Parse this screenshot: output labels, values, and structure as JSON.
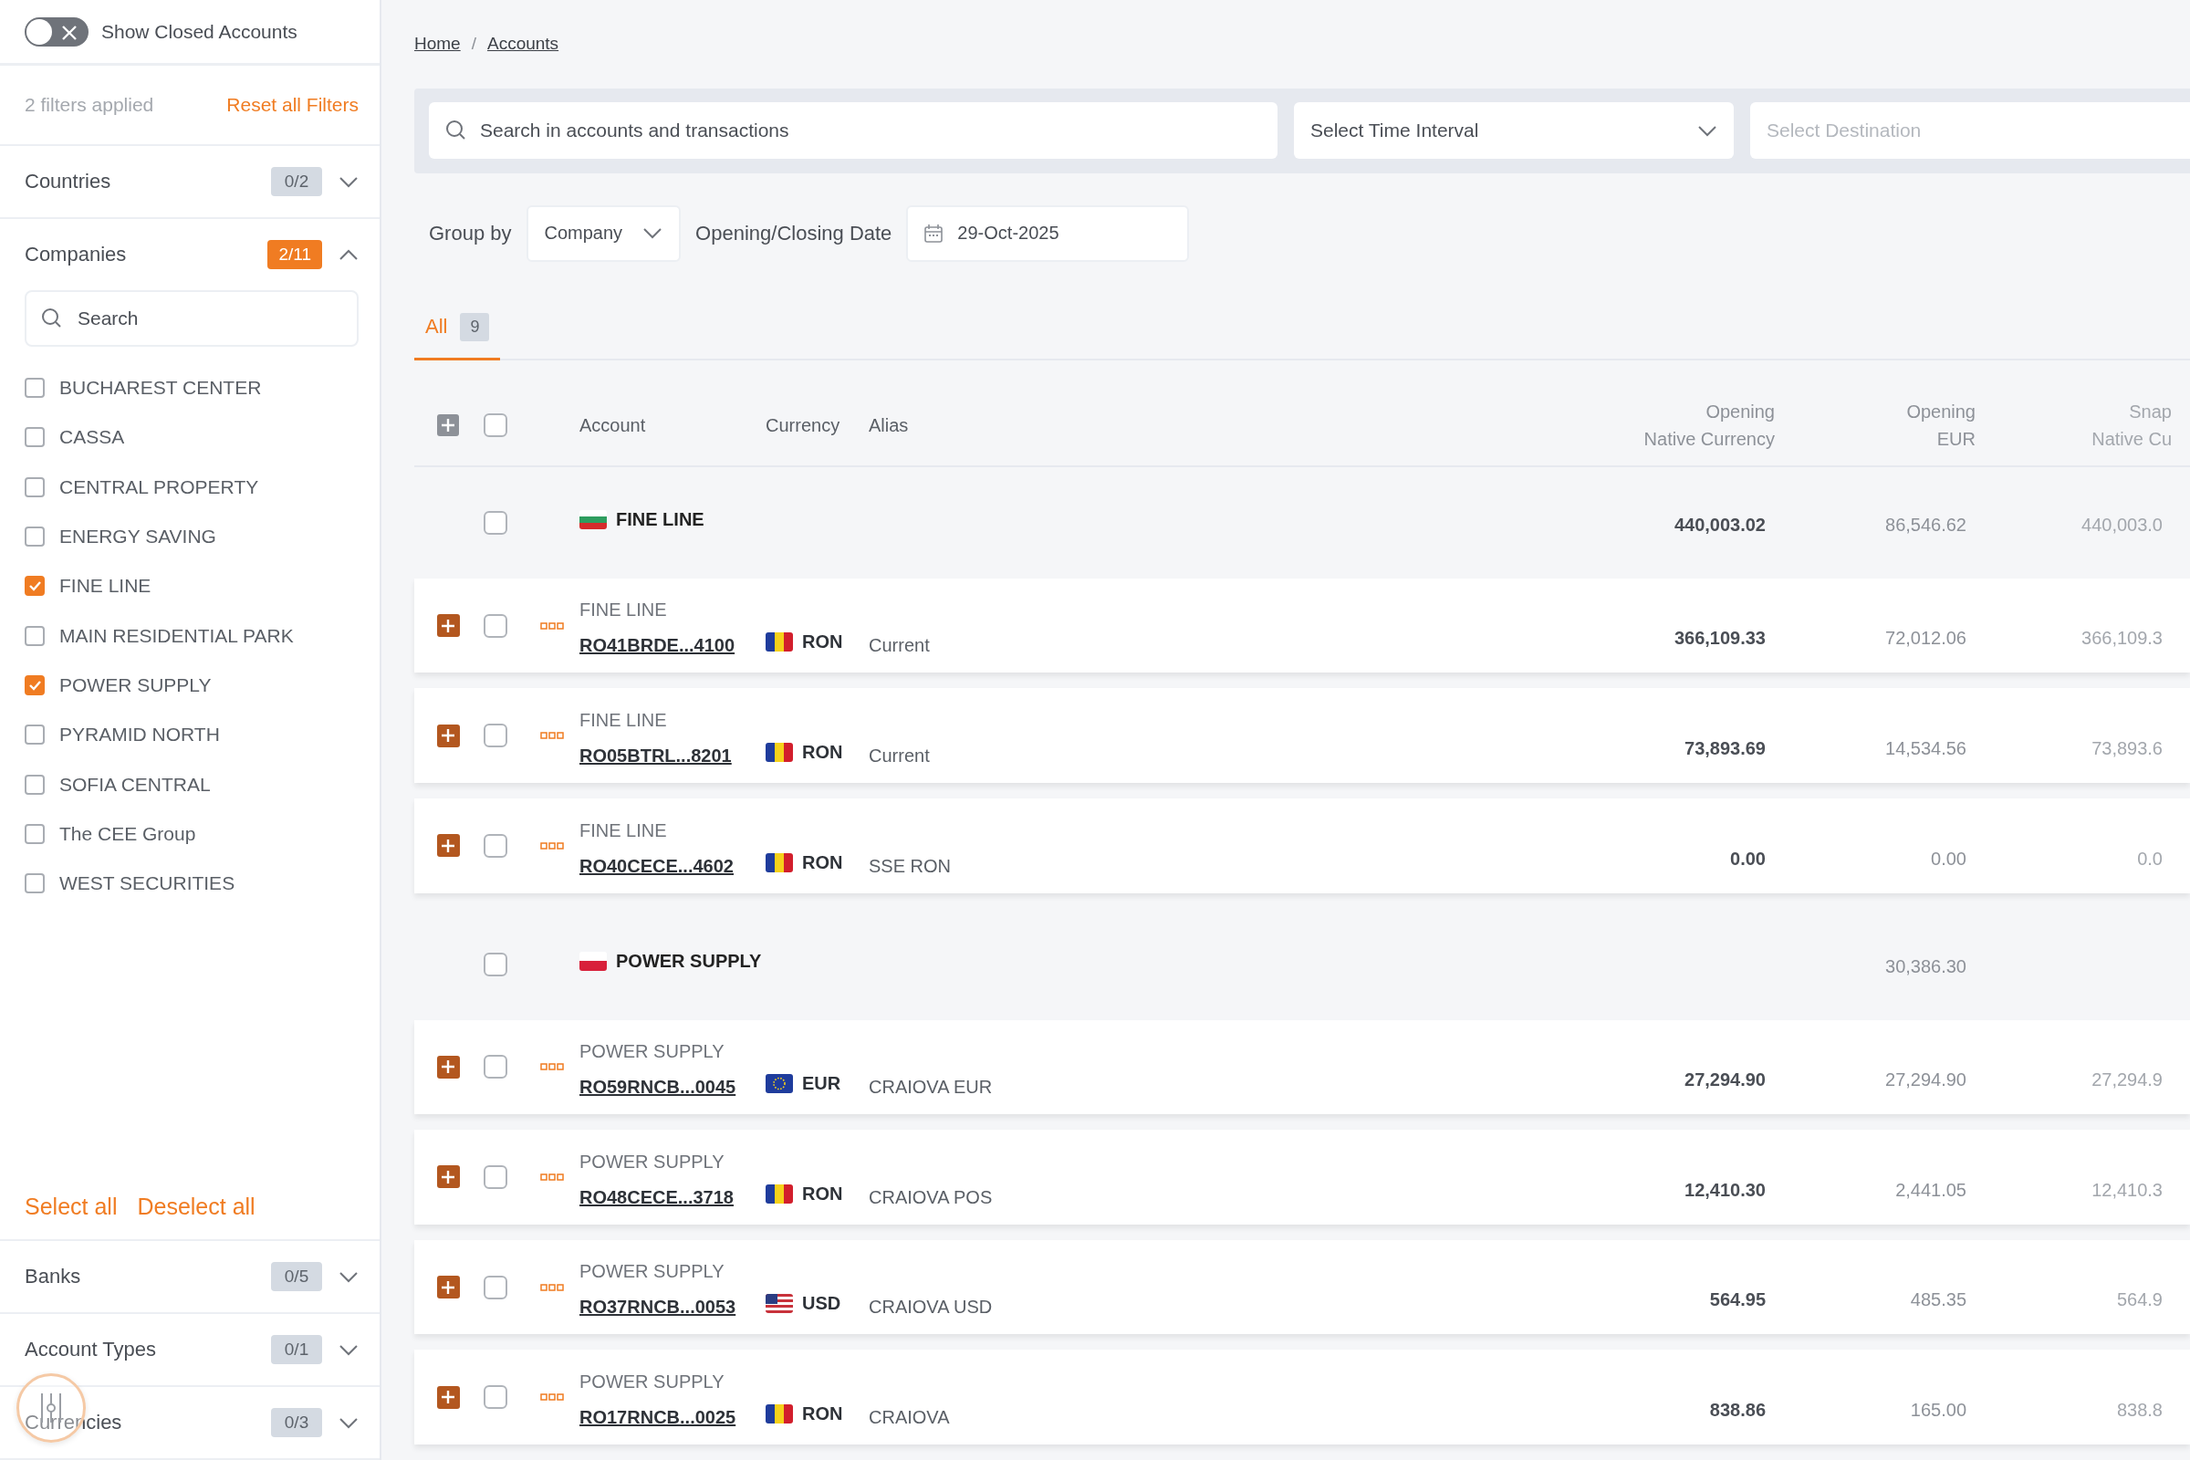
{
  "sidebar": {
    "closed_toggle": {
      "label": "Show Closed Accounts",
      "on": false
    },
    "filters_applied": "2 filters applied",
    "reset_link": "Reset all Filters",
    "sections": [
      {
        "title": "Countries",
        "count": "0/2",
        "active": false,
        "expanded": false
      },
      {
        "title": "Companies",
        "count": "2/11",
        "active": true,
        "expanded": true,
        "search": {
          "placeholder": "Search"
        },
        "options": [
          {
            "label": "BUCHAREST CENTER",
            "checked": false
          },
          {
            "label": "CASSA",
            "checked": false
          },
          {
            "label": "CENTRAL PROPERTY",
            "checked": false
          },
          {
            "label": "ENERGY SAVING",
            "checked": false
          },
          {
            "label": "FINE LINE",
            "checked": true
          },
          {
            "label": "MAIN RESIDENTIAL PARK",
            "checked": false
          },
          {
            "label": "POWER SUPPLY",
            "checked": true
          },
          {
            "label": "PYRAMID NORTH",
            "checked": false
          },
          {
            "label": "SOFIA CENTRAL",
            "checked": false
          },
          {
            "label": "The CEE Group",
            "checked": false
          },
          {
            "label": "WEST SECURITIES",
            "checked": false
          }
        ],
        "select_all": "Select all",
        "deselect_all": "Deselect all"
      },
      {
        "title": "Banks",
        "count": "0/5",
        "active": false,
        "expanded": false
      },
      {
        "title": "Account Types",
        "count": "0/1",
        "active": false,
        "expanded": false
      },
      {
        "title": "Currencies",
        "count": "0/3",
        "active": false,
        "expanded": false
      }
    ]
  },
  "breadcrumbs": {
    "separator": "/",
    "items": [
      "Home",
      "Accounts"
    ]
  },
  "filter_bar": {
    "search": {
      "placeholder": "Search in accounts and transactions"
    },
    "time_interval": {
      "label": "Select Time Interval"
    },
    "destination": {
      "placeholder": "Select Destination"
    }
  },
  "grouping": {
    "group_by_label": "Group by",
    "group_by_value": "Company",
    "date_label": "Opening/Closing Date",
    "date_value": "29-Oct-2025"
  },
  "tabs": [
    {
      "label": "All",
      "count": "9",
      "selected": true
    }
  ],
  "table": {
    "select_all_checked": false,
    "columns": [
      "Account",
      "Currency",
      "Alias",
      "Opening\nNative Currency",
      "Opening\nEUR",
      "Snap\nNative Cu"
    ],
    "rows": [
      {
        "kind": "group",
        "name": "FINE LINE",
        "flag": {
          "kind": "bg"
        },
        "checked": false,
        "opening_native": "440,003.02",
        "opening_eur": "86,546.62",
        "column_3": "440,003.0"
      },
      {
        "kind": "account",
        "company": "FINE LINE",
        "iban": "RO41BRDE...4100",
        "flag": {
          "kind": "ro"
        },
        "currency": "RON",
        "alias": "Current",
        "checked": false,
        "opening_native": "366,109.33",
        "opening_eur": "72,012.06",
        "column_3": "366,109.3"
      },
      {
        "kind": "account",
        "company": "FINE LINE",
        "iban": "RO05BTRL...8201",
        "flag": {
          "kind": "ro"
        },
        "currency": "RON",
        "alias": "Current",
        "checked": false,
        "opening_native": "73,893.69",
        "opening_eur": "14,534.56",
        "column_3": "73,893.6"
      },
      {
        "kind": "account",
        "company": "FINE LINE",
        "iban": "RO40CECE...4602",
        "flag": {
          "kind": "ro"
        },
        "currency": "RON",
        "alias": "SSE RON",
        "checked": false,
        "opening_native": "0.00",
        "opening_eur": "0.00",
        "column_3": "0.0"
      },
      {
        "kind": "group",
        "name": "POWER SUPPLY",
        "flag": {
          "kind": "pl"
        },
        "checked": false,
        "opening_eur": "30,386.30"
      },
      {
        "kind": "account",
        "company": "POWER SUPPLY",
        "iban": "RO59RNCB...0045",
        "flag": {
          "kind": "eu"
        },
        "currency": "EUR",
        "alias": "CRAIOVA EUR",
        "checked": false,
        "opening_native": "27,294.90",
        "opening_eur": "27,294.90",
        "column_3": "27,294.9"
      },
      {
        "kind": "account",
        "company": "POWER SUPPLY",
        "iban": "RO48CECE...3718",
        "flag": {
          "kind": "ro"
        },
        "currency": "RON",
        "alias": "CRAIOVA POS",
        "checked": false,
        "opening_native": "12,410.30",
        "opening_eur": "2,441.05",
        "column_3": "12,410.3"
      },
      {
        "kind": "account",
        "company": "POWER SUPPLY",
        "iban": "RO37RNCB...0053",
        "flag": {
          "kind": "us"
        },
        "currency": "USD",
        "alias": "CRAIOVA USD",
        "checked": false,
        "opening_native": "564.95",
        "opening_eur": "485.35",
        "column_3": "564.9"
      },
      {
        "kind": "account",
        "company": "POWER SUPPLY",
        "iban": "RO17RNCB...0025",
        "flag": {
          "kind": "ro"
        },
        "currency": "RON",
        "alias": "CRAIOVA",
        "checked": false,
        "opening_native": "838.86",
        "opening_eur": "165.00",
        "column_3": "838.8"
      }
    ]
  }
}
